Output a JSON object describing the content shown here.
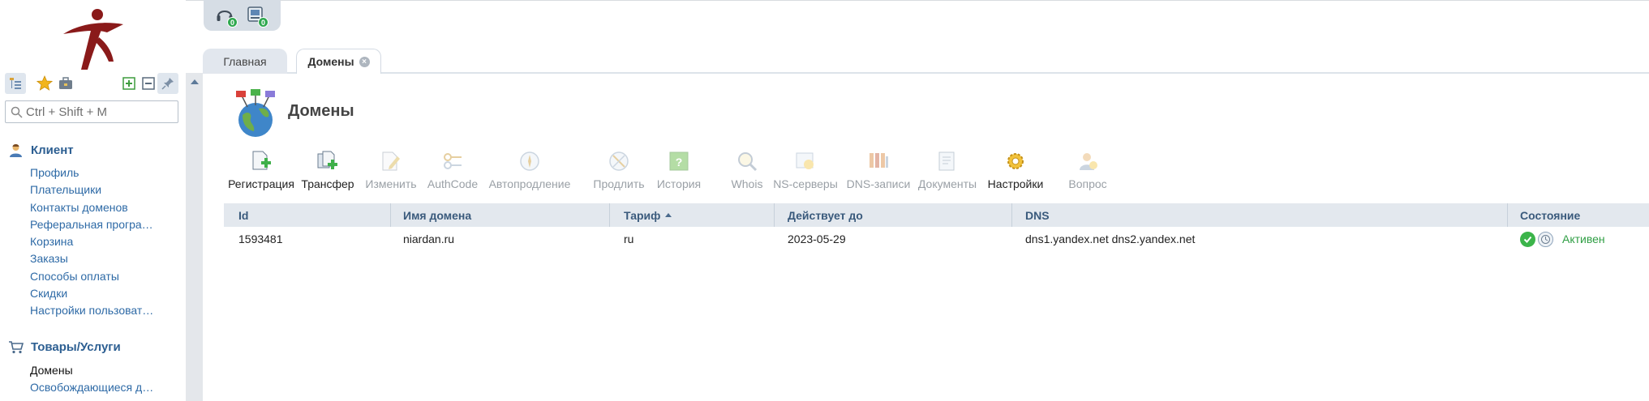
{
  "sidebar": {
    "search": {
      "placeholder": "Ctrl + Shift + M"
    },
    "sections": [
      {
        "title": "Клиент",
        "icon": "user-icon",
        "items": [
          "Профиль",
          "Плательщики",
          "Контакты доменов",
          "Реферальная програ…",
          "Корзина",
          "Заказы",
          "Способы оплаты",
          "Скидки",
          "Настройки пользоват…"
        ]
      },
      {
        "title": "Товары/Услуги",
        "icon": "cart-icon",
        "items": [
          "Домены",
          "Освобождающиеся д…"
        ]
      }
    ]
  },
  "notifications": [
    {
      "icon": "headset-icon",
      "count": "0"
    },
    {
      "icon": "monitor-icon",
      "count": "0"
    }
  ],
  "tabs": [
    {
      "label": "Главная"
    },
    {
      "label": "Домены"
    }
  ],
  "page": {
    "title": "Домены"
  },
  "toolbar": [
    {
      "label": "Регистрация",
      "icon": "register-icon",
      "enabled": true
    },
    {
      "label": "Трансфер",
      "icon": "transfer-icon",
      "enabled": true
    },
    {
      "label": "Изменить",
      "icon": "edit-icon",
      "enabled": false
    },
    {
      "label": "AuthCode",
      "icon": "key-icon",
      "enabled": false
    },
    {
      "label": "Автопродление",
      "icon": "autorenew-icon",
      "enabled": false
    },
    {
      "label": "Продлить",
      "icon": "renew-icon",
      "enabled": false
    },
    {
      "label": "История",
      "icon": "history-icon",
      "enabled": false
    },
    {
      "label": "Whois",
      "icon": "whois-icon",
      "enabled": false
    },
    {
      "label": "NS-серверы",
      "icon": "ns-servers-icon",
      "enabled": false
    },
    {
      "label": "DNS-записи",
      "icon": "dns-records-icon",
      "enabled": false
    },
    {
      "label": "Документы",
      "icon": "documents-icon",
      "enabled": false
    },
    {
      "label": "Настройки",
      "icon": "settings-gear-icon",
      "enabled": true
    },
    {
      "label": "Вопрос",
      "icon": "question-icon",
      "enabled": false
    }
  ],
  "table": {
    "columns": [
      "Id",
      "Имя домена",
      "Тариф",
      "Действует до",
      "DNS",
      "Состояние"
    ],
    "sorted_column": "Тариф",
    "rows": [
      {
        "id": "1593481",
        "domain": "niardan.ru",
        "tariff": "ru",
        "expires": "2023-05-29",
        "dns": "dns1.yandex.net dns2.yandex.net",
        "state": "Активен"
      }
    ]
  },
  "colors": {
    "link": "#2e6aa6",
    "header_bg": "#e3e8ee",
    "active_status": "#2f9e44"
  }
}
